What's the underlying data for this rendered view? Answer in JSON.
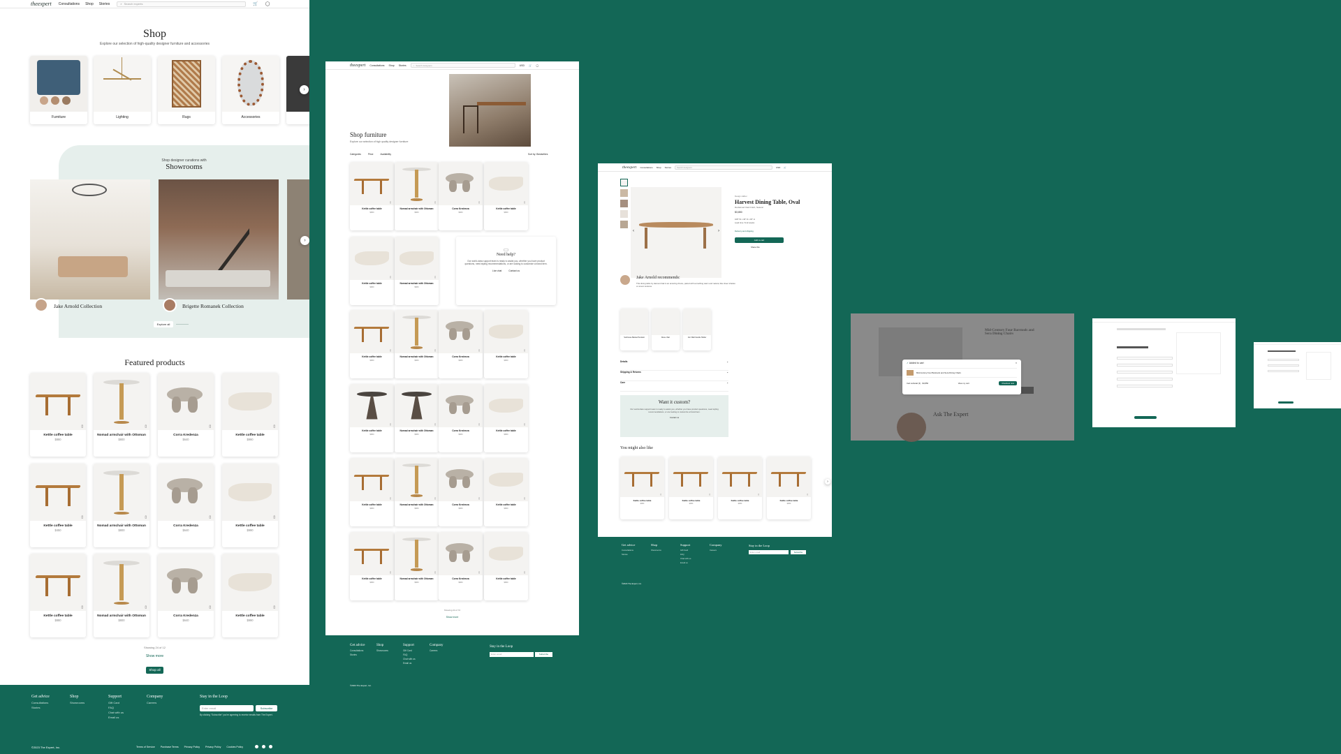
{
  "screen1": {
    "logo": "theexpert",
    "nav": [
      "Consultations",
      "Shop",
      "Stories"
    ],
    "search_placeholder": "Search experts",
    "title": "Shop",
    "subtitle": "Explore our selection of high-quality designer furniture and accessories",
    "categories": [
      "Furniture",
      "Lighting",
      "Rugs",
      "Accessories"
    ],
    "showrooms_kicker": "Shop designer curations with",
    "showrooms_title": "Showrooms",
    "showrooms": [
      "Jake Arnold Collection",
      "Brigette Romanek Collection"
    ],
    "explore_all": "Explore all",
    "featured_title": "Featured products",
    "products": [
      {
        "name": "Kettle coffee table",
        "price": "$880"
      },
      {
        "name": "Nomad armchair with Ottoman",
        "price": "$800"
      },
      {
        "name": "Corra Kredenza",
        "price": "$640"
      },
      {
        "name": "Kettle coffee table",
        "price": "$990"
      },
      {
        "name": "Kettle coffee table",
        "price": "$450"
      },
      {
        "name": "Nomad armchair with Ottoman",
        "price": "$800"
      },
      {
        "name": "Corra Kredenza",
        "price": "$640"
      },
      {
        "name": "Kettle coffee table",
        "price": "$990"
      },
      {
        "name": "Kettle coffee table",
        "price": "$880"
      },
      {
        "name": "Nomad armchair with Ottoman",
        "price": "$800"
      },
      {
        "name": "Corra Kredenza",
        "price": "$640"
      },
      {
        "name": "Kettle coffee table",
        "price": "$990"
      }
    ],
    "showing": "Showing 24 of 12",
    "show_more": "Show more",
    "shop_all": "Shop all"
  },
  "footer": {
    "cols": [
      {
        "title": "Get advice",
        "links": [
          "Consultations",
          "Stories"
        ]
      },
      {
        "title": "Shop",
        "links": [
          "Showrooms"
        ]
      },
      {
        "title": "Support",
        "links": [
          "Gift Card",
          "FAQ",
          "Chat with us",
          "Email us"
        ]
      },
      {
        "title": "Company",
        "links": [
          "Careers"
        ]
      }
    ],
    "newsletter_title": "Stay in the Loop",
    "email_placeholder": "Enter email",
    "subscribe": "Subscribe",
    "disclaimer": "By clicking \"Subscribe\" you're agreeing to receive emails from The Expert.",
    "copyright": "©2023 The Expert, Inc.",
    "legal": [
      "Terms of Service",
      "Purchase Terms",
      "Privacy Policy",
      "Privacy Policy",
      "Cookies Policy"
    ]
  },
  "screen2": {
    "title": "Shop furniture",
    "subtitle": "Explore our selection of high quality designer furniture",
    "filters": [
      "Categories",
      "Price",
      "Availability"
    ],
    "sort": "Sort by: Bestsellers",
    "search_placeholder": "Search designers",
    "currency": "USD",
    "help_title": "Need help?",
    "help_text": "Our world-class support team is ready to assist you, whether you have product questions, need styling recommendations, or are looking to customize a brand item.",
    "live_chat": "Live chat",
    "contact": "Contact us",
    "names": [
      "Kettle coffee table",
      "Nomad armchair with Ottoman",
      "Corra Kredenza",
      "Kettle coffee table"
    ],
    "price": "$880",
    "showing": "Showing 24 of 72",
    "show_more": "Show more"
  },
  "screen3": {
    "brand": "Design caliber",
    "title": "Harvest Dining Table, Oval",
    "subtitle": "Reclaimed Oak Finish, Natural",
    "price": "$3,850",
    "dims": "108\" W x 46\" D x 30\" H",
    "lead": "Lead time: 8-12 weeks",
    "delivery": "Delivery and shipping",
    "add_to_cart": "Add to cart",
    "share": "Share this",
    "rec_title": "Jake Arnold recommends:",
    "rec_text": "This dining table by Harvest Oak is an amazing choice, paired with something warm and natural, like sheer shades or woven textures.",
    "accordion": [
      "Details",
      "Shipping & Returns",
      "Care"
    ],
    "custom_title": "Want it custom?",
    "custom_text": "Our world-class support team is ready to assist you, whether you have product questions, need styling recommendations, or are looking to customize a brand item.",
    "custom_btn": "Contact us",
    "also_like": "You might also like",
    "also_name": "Kettle coffee table",
    "also_price": "$880",
    "rel": [
      "Sunhouse Basket Pendant",
      "Rene chair",
      "Iron Wall Candle Holder"
    ]
  },
  "screen4": {
    "added": "Added to cart",
    "item": "Mid-Century Four Barstools and Sera Dining Chairs",
    "subtotal": "Cart subtotal (3) · $3,850",
    "view_cart": "View my cart",
    "checkout": "Checkout now",
    "ask_title": "Ask The Expert"
  }
}
